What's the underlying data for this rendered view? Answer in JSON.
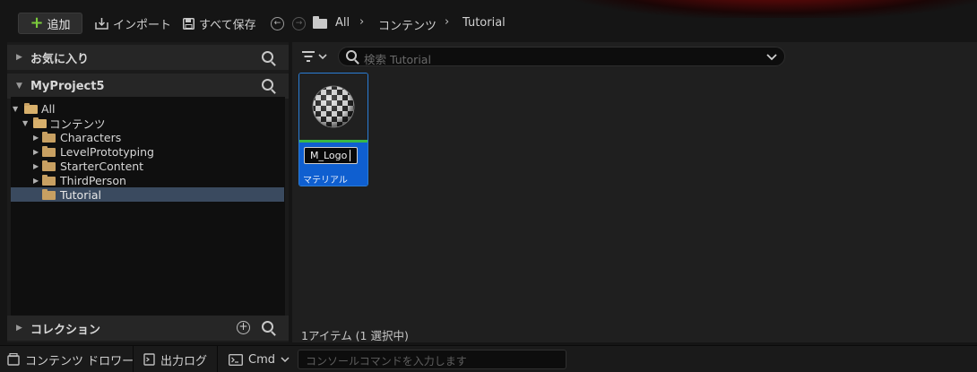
{
  "toolbar": {
    "add_label": "追加",
    "import_label": "インポート",
    "save_all_label": "すべて保存",
    "breadcrumb": [
      "All",
      "コンテンツ",
      "Tutorial"
    ]
  },
  "left_panel": {
    "favorites_title": "お気に入り",
    "project_title": "MyProject5",
    "tree": [
      {
        "label": "All"
      },
      {
        "label": "コンテンツ"
      },
      {
        "label": "Characters"
      },
      {
        "label": "LevelPrototyping"
      },
      {
        "label": "StarterContent"
      },
      {
        "label": "ThirdPerson"
      },
      {
        "label": "Tutorial"
      }
    ],
    "collections_title": "コレクション"
  },
  "content": {
    "search_placeholder": "検索 Tutorial",
    "asset": {
      "name": "M_Logo",
      "type": "マテリアル"
    },
    "item_count": "1アイテム (1 選択中)"
  },
  "status_bar": {
    "content_drawer": "コンテンツ ドロワー",
    "output_log": "出力ログ",
    "cmd_label": "Cmd",
    "cmd_placeholder": "コンソールコマンドを入力します"
  },
  "colors": {
    "accent_blue": "#0f5fd0",
    "selection": "#3a4a5f",
    "folder": "#c8a062",
    "add_green": "#7ccb3c"
  }
}
